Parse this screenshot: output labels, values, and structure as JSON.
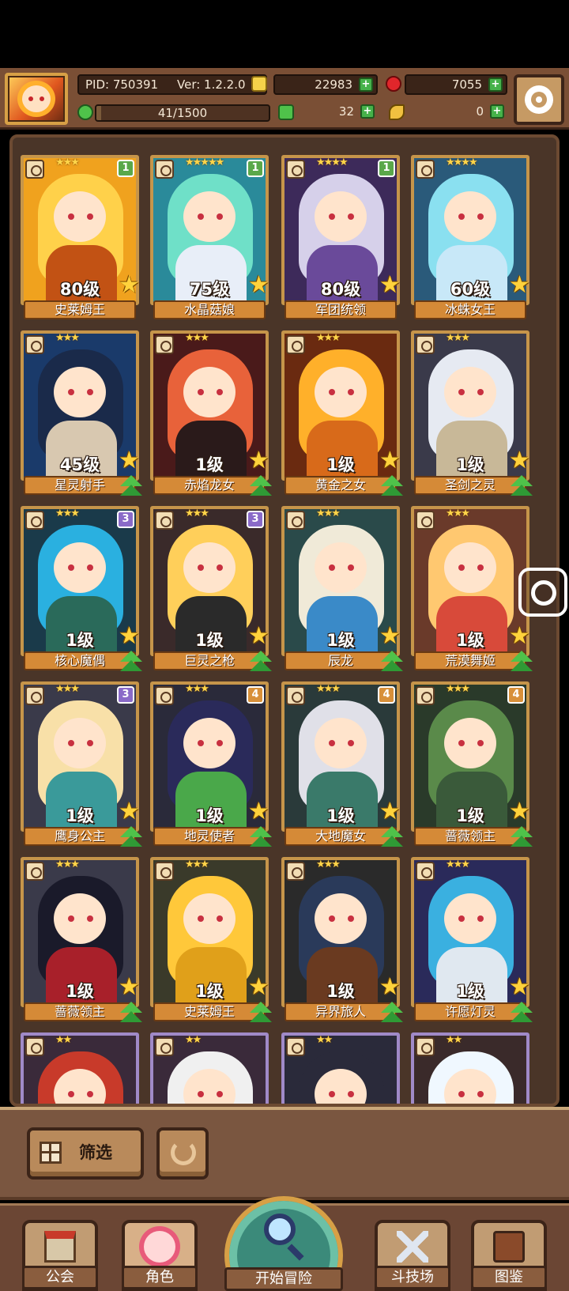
{
  "header": {
    "pid": "PID: 750391",
    "version": "Ver: 1.2.2.0",
    "gold": "22983",
    "gems": "7055",
    "exp": "41/1500",
    "exp_fraction": 0.027,
    "clover": "32",
    "key": "0"
  },
  "heroes": [
    {
      "name": "史莱姆王",
      "level": "80级",
      "stars": "★★★",
      "rank": "1",
      "rank_color": "#5aa84a",
      "colors": [
        "#f0a21e",
        "#ffd14a",
        "#c25214"
      ],
      "frame": "gold"
    },
    {
      "name": "水晶菇娘",
      "level": "75级",
      "stars": "★★★★★",
      "rank": "1",
      "rank_color": "#5aa84a",
      "colors": [
        "#2a8a9a",
        "#6fe0c8",
        "#e8eef8"
      ],
      "frame": "gold"
    },
    {
      "name": "军团统领",
      "level": "80级",
      "stars": "★★★★",
      "rank": "1",
      "rank_color": "#5aa84a",
      "colors": [
        "#3d2a5a",
        "#d6d0ea",
        "#6a4a9a"
      ],
      "frame": "gold"
    },
    {
      "name": "冰蛛女王",
      "level": "60级",
      "stars": "★★★★",
      "rank": "",
      "rank_color": "",
      "colors": [
        "#2a5a7a",
        "#8ae0f0",
        "#c8e8f8"
      ],
      "frame": "gold"
    },
    {
      "name": "星灵射手",
      "level": "45级",
      "stars": "★★★",
      "rank": "",
      "rank_color": "",
      "colors": [
        "#1a3a6a",
        "#1a2a4a",
        "#d8c8b0"
      ],
      "frame": "gold"
    },
    {
      "name": "赤焰龙女",
      "level": "1级",
      "stars": "★★★",
      "rank": "",
      "rank_color": "",
      "colors": [
        "#4a1a1a",
        "#e8623a",
        "#2a1a1a"
      ],
      "frame": "gold"
    },
    {
      "name": "黄金之女",
      "level": "1级",
      "stars": "★★★",
      "rank": "",
      "rank_color": "",
      "colors": [
        "#6a2a10",
        "#ffb02a",
        "#d86a1a"
      ],
      "frame": "gold"
    },
    {
      "name": "圣剑之灵",
      "level": "1级",
      "stars": "★★★",
      "rank": "",
      "rank_color": "",
      "colors": [
        "#3a3a4a",
        "#e6eaf2",
        "#c8b898"
      ],
      "frame": "gold"
    },
    {
      "name": "核心魔偶",
      "level": "1级",
      "stars": "★★★",
      "rank": "3",
      "rank_color": "#8a6ac8",
      "colors": [
        "#1a3a4a",
        "#2ab0e0",
        "#2a6a5a"
      ],
      "frame": "gold"
    },
    {
      "name": "巨灵之枪",
      "level": "1级",
      "stars": "★★★",
      "rank": "3",
      "rank_color": "#8a6ac8",
      "colors": [
        "#3a2a2a",
        "#ffcf5a",
        "#2a2a2a"
      ],
      "frame": "gold"
    },
    {
      "name": "辰龙",
      "level": "1级",
      "stars": "★★★",
      "rank": "",
      "rank_color": "",
      "colors": [
        "#2a4a4a",
        "#f0ead8",
        "#3a8ac8"
      ],
      "frame": "gold"
    },
    {
      "name": "荒漠舞姬",
      "level": "1级",
      "stars": "★★★",
      "rank": "",
      "rank_color": "",
      "colors": [
        "#6a3a2a",
        "#ffc870",
        "#d84a3a"
      ],
      "frame": "gold"
    },
    {
      "name": "鹰身公主",
      "level": "1级",
      "stars": "★★★",
      "rank": "3",
      "rank_color": "#8a6ac8",
      "colors": [
        "#3a3a4a",
        "#f8e0a8",
        "#3a9a9a"
      ],
      "frame": "gold"
    },
    {
      "name": "地灵使者",
      "level": "1级",
      "stars": "★★★",
      "rank": "4",
      "rank_color": "#d8903a",
      "colors": [
        "#2a2a3a",
        "#2a2a5a",
        "#4aa84a"
      ],
      "frame": "gold"
    },
    {
      "name": "大地魔女",
      "level": "1级",
      "stars": "★★★",
      "rank": "4",
      "rank_color": "#d8903a",
      "colors": [
        "#2a3a3a",
        "#e0e0e8",
        "#3a7a6a"
      ],
      "frame": "gold"
    },
    {
      "name": "蔷薇领主",
      "level": "1级",
      "stars": "★★★",
      "rank": "4",
      "rank_color": "#d8903a",
      "colors": [
        "#2a3a2a",
        "#5a8a4a",
        "#3a5a3a"
      ],
      "frame": "gold"
    },
    {
      "name": "蔷薇领主",
      "level": "1级",
      "stars": "★★★",
      "rank": "",
      "rank_color": "",
      "colors": [
        "#3a3a4a",
        "#1a1a2a",
        "#a8202a"
      ],
      "frame": "gold"
    },
    {
      "name": "史莱姆王",
      "level": "1级",
      "stars": "★★★",
      "rank": "",
      "rank_color": "",
      "colors": [
        "#3a3a2a",
        "#ffc83a",
        "#e0a01a"
      ],
      "frame": "gold"
    },
    {
      "name": "异界旅人",
      "level": "1级",
      "stars": "★★★",
      "rank": "",
      "rank_color": "",
      "colors": [
        "#2a2a2a",
        "#2a3a5a",
        "#6a3a20"
      ],
      "frame": "gold"
    },
    {
      "name": "许愿灯灵",
      "level": "1级",
      "stars": "★★★",
      "rank": "",
      "rank_color": "",
      "colors": [
        "#2a2a5a",
        "#3ab0e0",
        "#e0e8f0"
      ],
      "frame": "gold"
    },
    {
      "name": "",
      "level": "",
      "stars": "★★",
      "rank": "",
      "rank_color": "",
      "colors": [
        "#3a2a3a",
        "#c83a2a",
        "#2a2a2a"
      ],
      "frame": "purple"
    },
    {
      "name": "",
      "level": "",
      "stars": "★★",
      "rank": "",
      "rank_color": "",
      "colors": [
        "#3a2a3a",
        "#f0f0f0",
        "#2a2a2a"
      ],
      "frame": "purple"
    },
    {
      "name": "",
      "level": "",
      "stars": "★★",
      "rank": "",
      "rank_color": "",
      "colors": [
        "#2a2a3a",
        "#2a2a3a",
        "#3a3a4a"
      ],
      "frame": "purple"
    },
    {
      "name": "",
      "level": "",
      "stars": "★★",
      "rank": "",
      "rank_color": "",
      "colors": [
        "#3a2a2a",
        "#f0f8ff",
        "#8a3a2a"
      ],
      "frame": "purple"
    }
  ],
  "filter": {
    "label": "筛选"
  },
  "nav": {
    "guild": "公会",
    "character": "角色",
    "adventure": "开始冒险",
    "arena": "斗技场",
    "codex": "图鉴"
  }
}
